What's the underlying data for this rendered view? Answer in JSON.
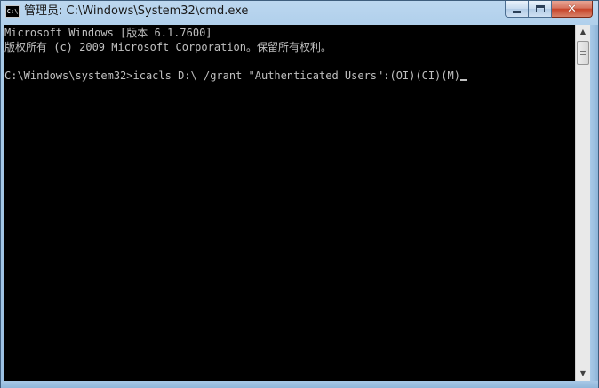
{
  "window": {
    "title": "管理员: C:\\Windows\\System32\\cmd.exe",
    "app_icon_text": "C:\\",
    "minimize_glyph": "minimize-icon",
    "maximize_glyph": "maximize-icon",
    "close_glyph": "✕"
  },
  "console": {
    "lines": [
      "Microsoft Windows [版本 6.1.7600]",
      "版权所有 (c) 2009 Microsoft Corporation。保留所有权利。",
      "",
      "C:\\Windows\\system32>icacls D:\\ /grant \"Authenticated Users\":(OI)(CI)(M)"
    ],
    "text_color": "#c0c0c0",
    "background_color": "#000000"
  },
  "scrollbar": {
    "up_arrow": "▲",
    "down_arrow": "▼"
  }
}
